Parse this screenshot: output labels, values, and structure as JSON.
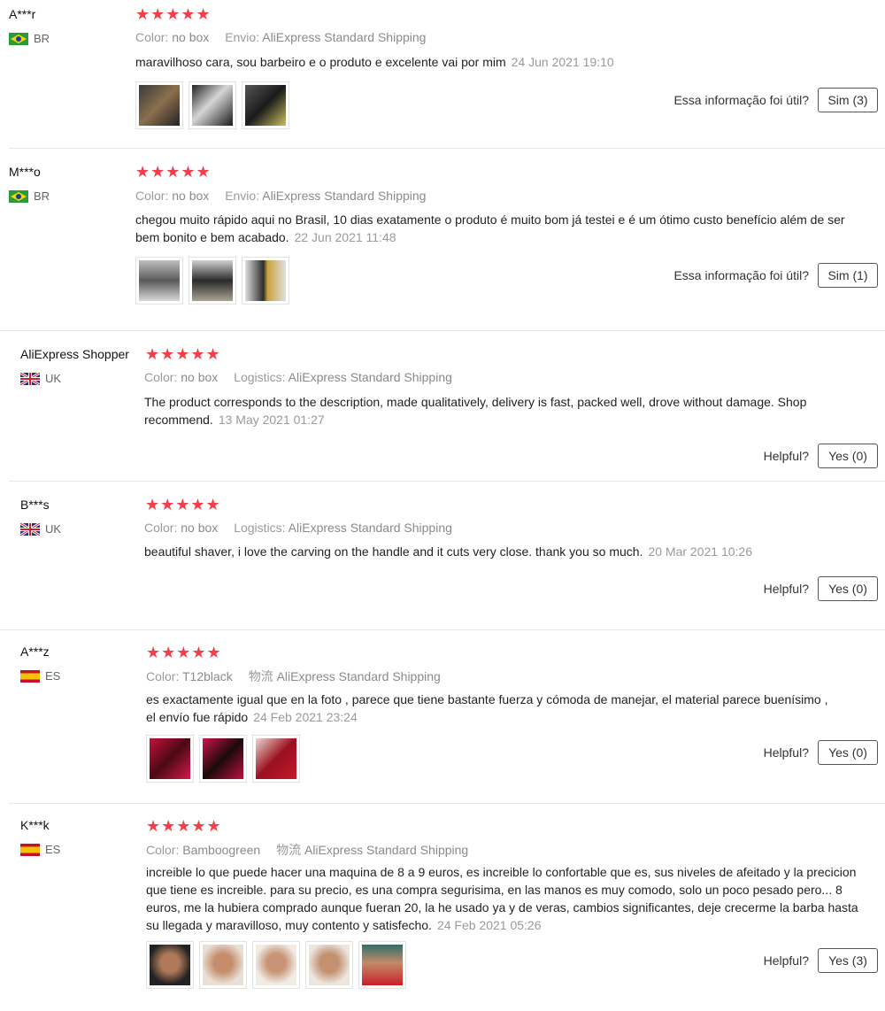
{
  "colors": {
    "star": "#f33f4a",
    "divider": "#e6e6e6",
    "muted": "#9a9a9a"
  },
  "reviews": [
    {
      "user": "A***r",
      "country": "BR",
      "flag": "brazil-flag-icon",
      "stars": "★★★★★",
      "meta_k1": "Color:",
      "meta_v1": "no box",
      "meta_k2": "Envio:",
      "meta_v2": "AliExpress Standard Shipping",
      "text": "maravilhoso cara, sou barbeiro e o produto e excelente vai por mim",
      "date": "24 Jun 2021 19:10",
      "helpful_label": "Essa informação foi útil?",
      "helpful_button": "Sim (3)"
    },
    {
      "user": "M***o",
      "country": "BR",
      "flag": "brazil-flag-icon",
      "stars": "★★★★★",
      "meta_k1": "Color:",
      "meta_v1": "no box",
      "meta_k2": "Envio:",
      "meta_v2": "AliExpress Standard Shipping",
      "text": "chegou muito rápido aqui no Brasil, 10 dias exatamente o produto é muito bom já testei e é um ótimo custo benefício além de ser bem bonito e bem acabado.",
      "date": "22 Jun 2021 11:48",
      "helpful_label": "Essa informação foi útil?",
      "helpful_button": "Sim (1)"
    },
    {
      "user": "AliExpress Shopper",
      "country": "UK",
      "flag": "uk-flag-icon",
      "stars": "★★★★★",
      "meta_k1": "Color:",
      "meta_v1": "no box",
      "meta_k2": "Logistics:",
      "meta_v2": "AliExpress Standard Shipping",
      "text": "The product corresponds to the description, made qualitatively, delivery is fast, packed well, drove without damage. Shop recommend.",
      "date": "13 May 2021 01:27",
      "helpful_label": "Helpful?",
      "helpful_button": "Yes (0)"
    },
    {
      "user": "B***s",
      "country": "UK",
      "flag": "uk-flag-icon",
      "stars": "★★★★★",
      "meta_k1": "Color:",
      "meta_v1": "no box",
      "meta_k2": "Logistics:",
      "meta_v2": "AliExpress Standard Shipping",
      "text": "beautiful shaver, i love the carving on the handle and it cuts very close. thank you so much.",
      "date": "20 Mar 2021 10:26",
      "helpful_label": "Helpful?",
      "helpful_button": "Yes (0)"
    },
    {
      "user": "A***z",
      "country": "ES",
      "flag": "spain-flag-icon",
      "stars": "★★★★★",
      "meta_k1": "Color:",
      "meta_v1": "T12black",
      "meta_k2": "物流",
      "meta_v2": "AliExpress Standard Shipping",
      "text": "es exactamente igual que en la foto , parece que tiene bastante fuerza y cómoda de manejar, el material parece buenísimo , el envío fue rápido",
      "date": "24 Feb 2021 23:24",
      "helpful_label": "Helpful?",
      "helpful_button": "Yes (0)"
    },
    {
      "user": "K***k",
      "country": "ES",
      "flag": "spain-flag-icon",
      "stars": "★★★★★",
      "meta_k1": "Color:",
      "meta_v1": "Bamboogreen",
      "meta_k2": "物流",
      "meta_v2": "AliExpress Standard Shipping",
      "text": "increible lo que puede hacer una maquina de 8 a 9 euros, es increible lo confortable que es, sus niveles de afeitado y la precicion que tiene es increible. para su precio, es una compra segurisima, en las manos es muy comodo, solo un poco pesado pero... 8 euros, me la hubiera comprado aunque fueran 20, la he usado ya y de veras, cambios significantes, deje crecerme la barba hasta su llegada y maravilloso, muy contento y satisfecho.",
      "date": "24 Feb 2021 05:26",
      "helpful_label": "Helpful?",
      "helpful_button": "Yes (3)"
    }
  ]
}
